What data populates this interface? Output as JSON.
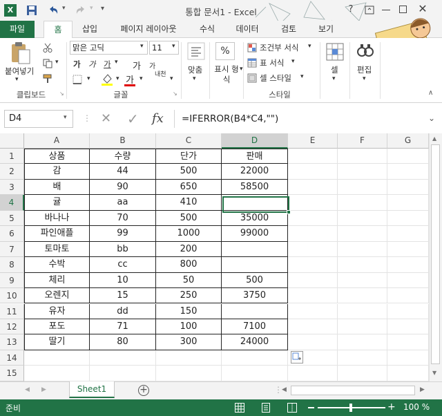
{
  "window": {
    "title": "통합 문서1 - Excel",
    "help": "?"
  },
  "tabs": [
    "파일",
    "홈",
    "삽입",
    "페이지 레이아웃",
    "수식",
    "데이터",
    "검토",
    "보기"
  ],
  "ribbon": {
    "clipboard": {
      "paste": "붙여넣기",
      "label": "클립보드"
    },
    "font": {
      "name": "맑은 고딕",
      "size": "11",
      "bold": "가",
      "italic": "가",
      "underline": "가",
      "grow": "가",
      "shrink": "가",
      "font_color": "가",
      "phonetic": "내천",
      "label": "글꼴"
    },
    "alignment": {
      "label": "맞춤"
    },
    "number": {
      "percent": "%",
      "label": "표시 형식"
    },
    "styles": {
      "conditional": "조건부 서식",
      "table": "표 서식",
      "cell_styles": "셀 스타일",
      "label": "스타일"
    },
    "cells": {
      "label": "셀"
    },
    "editing": {
      "label": "편집"
    }
  },
  "formula_bar": {
    "name_box": "D4",
    "cancel": "✕",
    "enter": "✓",
    "fx": "fx",
    "formula": "=IFERROR(B4*C4,\"\")"
  },
  "columns": [
    "A",
    "B",
    "C",
    "D",
    "E",
    "F",
    "G"
  ],
  "rows": [
    "1",
    "2",
    "3",
    "4",
    "5",
    "6",
    "7",
    "8",
    "9",
    "10",
    "11",
    "12",
    "13",
    "14",
    "15"
  ],
  "cells": [
    [
      "상품",
      "수량",
      "단가",
      "판매"
    ],
    [
      "감",
      "44",
      "500",
      "22000"
    ],
    [
      "배",
      "90",
      "650",
      "58500"
    ],
    [
      "귤",
      "aa",
      "410",
      ""
    ],
    [
      "바나나",
      "70",
      "500",
      "35000"
    ],
    [
      "파인애플",
      "99",
      "1000",
      "99000"
    ],
    [
      "토마토",
      "bb",
      "200",
      ""
    ],
    [
      "수박",
      "cc",
      "800",
      ""
    ],
    [
      "체리",
      "10",
      "50",
      "500"
    ],
    [
      "오렌지",
      "15",
      "250",
      "3750"
    ],
    [
      "유자",
      "dd",
      "150",
      ""
    ],
    [
      "포도",
      "71",
      "100",
      "7100"
    ],
    [
      "딸기",
      "80",
      "300",
      "24000"
    ]
  ],
  "selected_cell": "D4",
  "sheet_tabs": [
    "Sheet1"
  ],
  "status": {
    "mode": "준비",
    "zoom": "100 %"
  },
  "colors": {
    "excel_green": "#217346",
    "selection": "#217346"
  }
}
